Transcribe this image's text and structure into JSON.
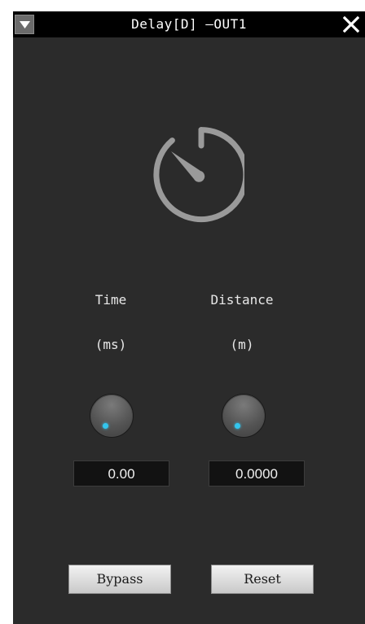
{
  "window": {
    "title": "Delay[D] —OUT1",
    "menu_icon": "dropdown-triangle-icon",
    "close_icon": "close-x-icon"
  },
  "icons": {
    "main": "timer-icon"
  },
  "controls": {
    "time": {
      "label": "Time",
      "unit": "(ms)",
      "value": "0.00",
      "knob_level": 0
    },
    "distance": {
      "label": "Distance",
      "unit": "(m)",
      "value": "0.0000",
      "knob_level": 0
    }
  },
  "buttons": {
    "bypass": "Bypass",
    "reset": "Reset"
  },
  "colors": {
    "background": "#2b2b2b",
    "titlebar": "#000000",
    "knob_indicator": "#33c6ee",
    "icon_gray": "#9a9a9a"
  }
}
